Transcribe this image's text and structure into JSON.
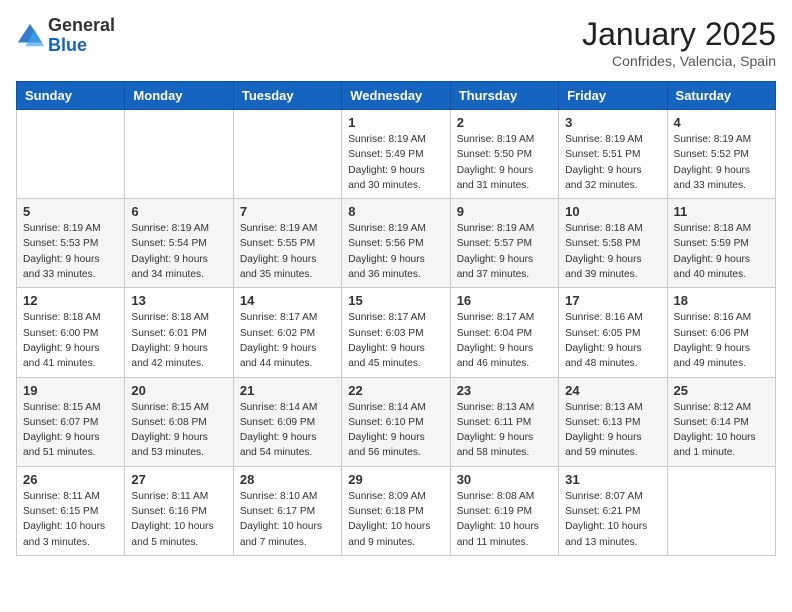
{
  "header": {
    "logo_general": "General",
    "logo_blue": "Blue",
    "month_title": "January 2025",
    "location": "Confrides, Valencia, Spain"
  },
  "days_of_week": [
    "Sunday",
    "Monday",
    "Tuesday",
    "Wednesday",
    "Thursday",
    "Friday",
    "Saturday"
  ],
  "weeks": [
    [
      {
        "day": "",
        "info": ""
      },
      {
        "day": "",
        "info": ""
      },
      {
        "day": "",
        "info": ""
      },
      {
        "day": "1",
        "info": "Sunrise: 8:19 AM\nSunset: 5:49 PM\nDaylight: 9 hours\nand 30 minutes."
      },
      {
        "day": "2",
        "info": "Sunrise: 8:19 AM\nSunset: 5:50 PM\nDaylight: 9 hours\nand 31 minutes."
      },
      {
        "day": "3",
        "info": "Sunrise: 8:19 AM\nSunset: 5:51 PM\nDaylight: 9 hours\nand 32 minutes."
      },
      {
        "day": "4",
        "info": "Sunrise: 8:19 AM\nSunset: 5:52 PM\nDaylight: 9 hours\nand 33 minutes."
      }
    ],
    [
      {
        "day": "5",
        "info": "Sunrise: 8:19 AM\nSunset: 5:53 PM\nDaylight: 9 hours\nand 33 minutes."
      },
      {
        "day": "6",
        "info": "Sunrise: 8:19 AM\nSunset: 5:54 PM\nDaylight: 9 hours\nand 34 minutes."
      },
      {
        "day": "7",
        "info": "Sunrise: 8:19 AM\nSunset: 5:55 PM\nDaylight: 9 hours\nand 35 minutes."
      },
      {
        "day": "8",
        "info": "Sunrise: 8:19 AM\nSunset: 5:56 PM\nDaylight: 9 hours\nand 36 minutes."
      },
      {
        "day": "9",
        "info": "Sunrise: 8:19 AM\nSunset: 5:57 PM\nDaylight: 9 hours\nand 37 minutes."
      },
      {
        "day": "10",
        "info": "Sunrise: 8:18 AM\nSunset: 5:58 PM\nDaylight: 9 hours\nand 39 minutes."
      },
      {
        "day": "11",
        "info": "Sunrise: 8:18 AM\nSunset: 5:59 PM\nDaylight: 9 hours\nand 40 minutes."
      }
    ],
    [
      {
        "day": "12",
        "info": "Sunrise: 8:18 AM\nSunset: 6:00 PM\nDaylight: 9 hours\nand 41 minutes."
      },
      {
        "day": "13",
        "info": "Sunrise: 8:18 AM\nSunset: 6:01 PM\nDaylight: 9 hours\nand 42 minutes."
      },
      {
        "day": "14",
        "info": "Sunrise: 8:17 AM\nSunset: 6:02 PM\nDaylight: 9 hours\nand 44 minutes."
      },
      {
        "day": "15",
        "info": "Sunrise: 8:17 AM\nSunset: 6:03 PM\nDaylight: 9 hours\nand 45 minutes."
      },
      {
        "day": "16",
        "info": "Sunrise: 8:17 AM\nSunset: 6:04 PM\nDaylight: 9 hours\nand 46 minutes."
      },
      {
        "day": "17",
        "info": "Sunrise: 8:16 AM\nSunset: 6:05 PM\nDaylight: 9 hours\nand 48 minutes."
      },
      {
        "day": "18",
        "info": "Sunrise: 8:16 AM\nSunset: 6:06 PM\nDaylight: 9 hours\nand 49 minutes."
      }
    ],
    [
      {
        "day": "19",
        "info": "Sunrise: 8:15 AM\nSunset: 6:07 PM\nDaylight: 9 hours\nand 51 minutes."
      },
      {
        "day": "20",
        "info": "Sunrise: 8:15 AM\nSunset: 6:08 PM\nDaylight: 9 hours\nand 53 minutes."
      },
      {
        "day": "21",
        "info": "Sunrise: 8:14 AM\nSunset: 6:09 PM\nDaylight: 9 hours\nand 54 minutes."
      },
      {
        "day": "22",
        "info": "Sunrise: 8:14 AM\nSunset: 6:10 PM\nDaylight: 9 hours\nand 56 minutes."
      },
      {
        "day": "23",
        "info": "Sunrise: 8:13 AM\nSunset: 6:11 PM\nDaylight: 9 hours\nand 58 minutes."
      },
      {
        "day": "24",
        "info": "Sunrise: 8:13 AM\nSunset: 6:13 PM\nDaylight: 9 hours\nand 59 minutes."
      },
      {
        "day": "25",
        "info": "Sunrise: 8:12 AM\nSunset: 6:14 PM\nDaylight: 10 hours\nand 1 minute."
      }
    ],
    [
      {
        "day": "26",
        "info": "Sunrise: 8:11 AM\nSunset: 6:15 PM\nDaylight: 10 hours\nand 3 minutes."
      },
      {
        "day": "27",
        "info": "Sunrise: 8:11 AM\nSunset: 6:16 PM\nDaylight: 10 hours\nand 5 minutes."
      },
      {
        "day": "28",
        "info": "Sunrise: 8:10 AM\nSunset: 6:17 PM\nDaylight: 10 hours\nand 7 minutes."
      },
      {
        "day": "29",
        "info": "Sunrise: 8:09 AM\nSunset: 6:18 PM\nDaylight: 10 hours\nand 9 minutes."
      },
      {
        "day": "30",
        "info": "Sunrise: 8:08 AM\nSunset: 6:19 PM\nDaylight: 10 hours\nand 11 minutes."
      },
      {
        "day": "31",
        "info": "Sunrise: 8:07 AM\nSunset: 6:21 PM\nDaylight: 10 hours\nand 13 minutes."
      },
      {
        "day": "",
        "info": ""
      }
    ]
  ]
}
